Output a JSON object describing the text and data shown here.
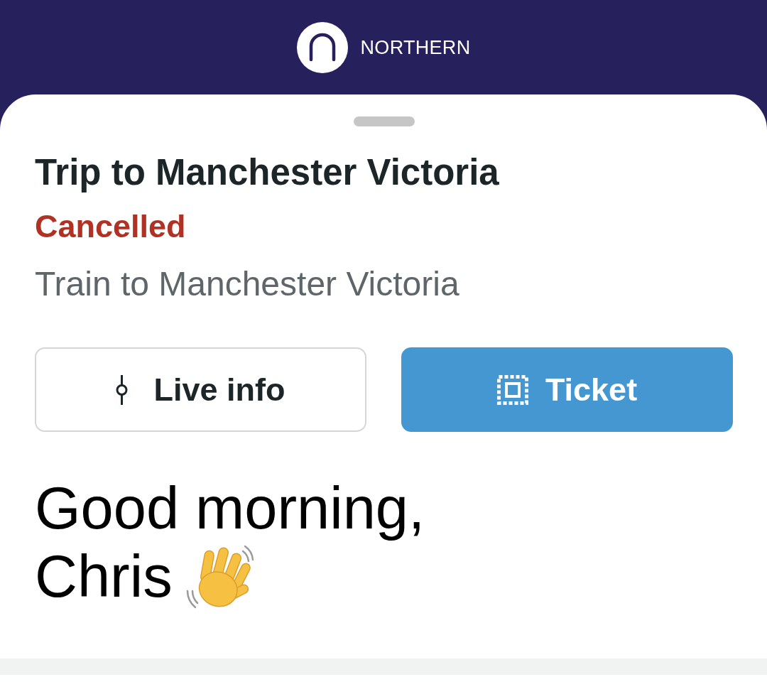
{
  "header": {
    "brand": "NORTHERN"
  },
  "trip": {
    "title": "Trip to Manchester Victoria",
    "status": "Cancelled",
    "description": "Train to Manchester Victoria",
    "actions": [
      {
        "label": "Live info",
        "kind": "outline"
      },
      {
        "label": "Ticket",
        "kind": "primary"
      }
    ]
  },
  "greeting": {
    "salutation": "Good morning,",
    "name": "Chris"
  }
}
